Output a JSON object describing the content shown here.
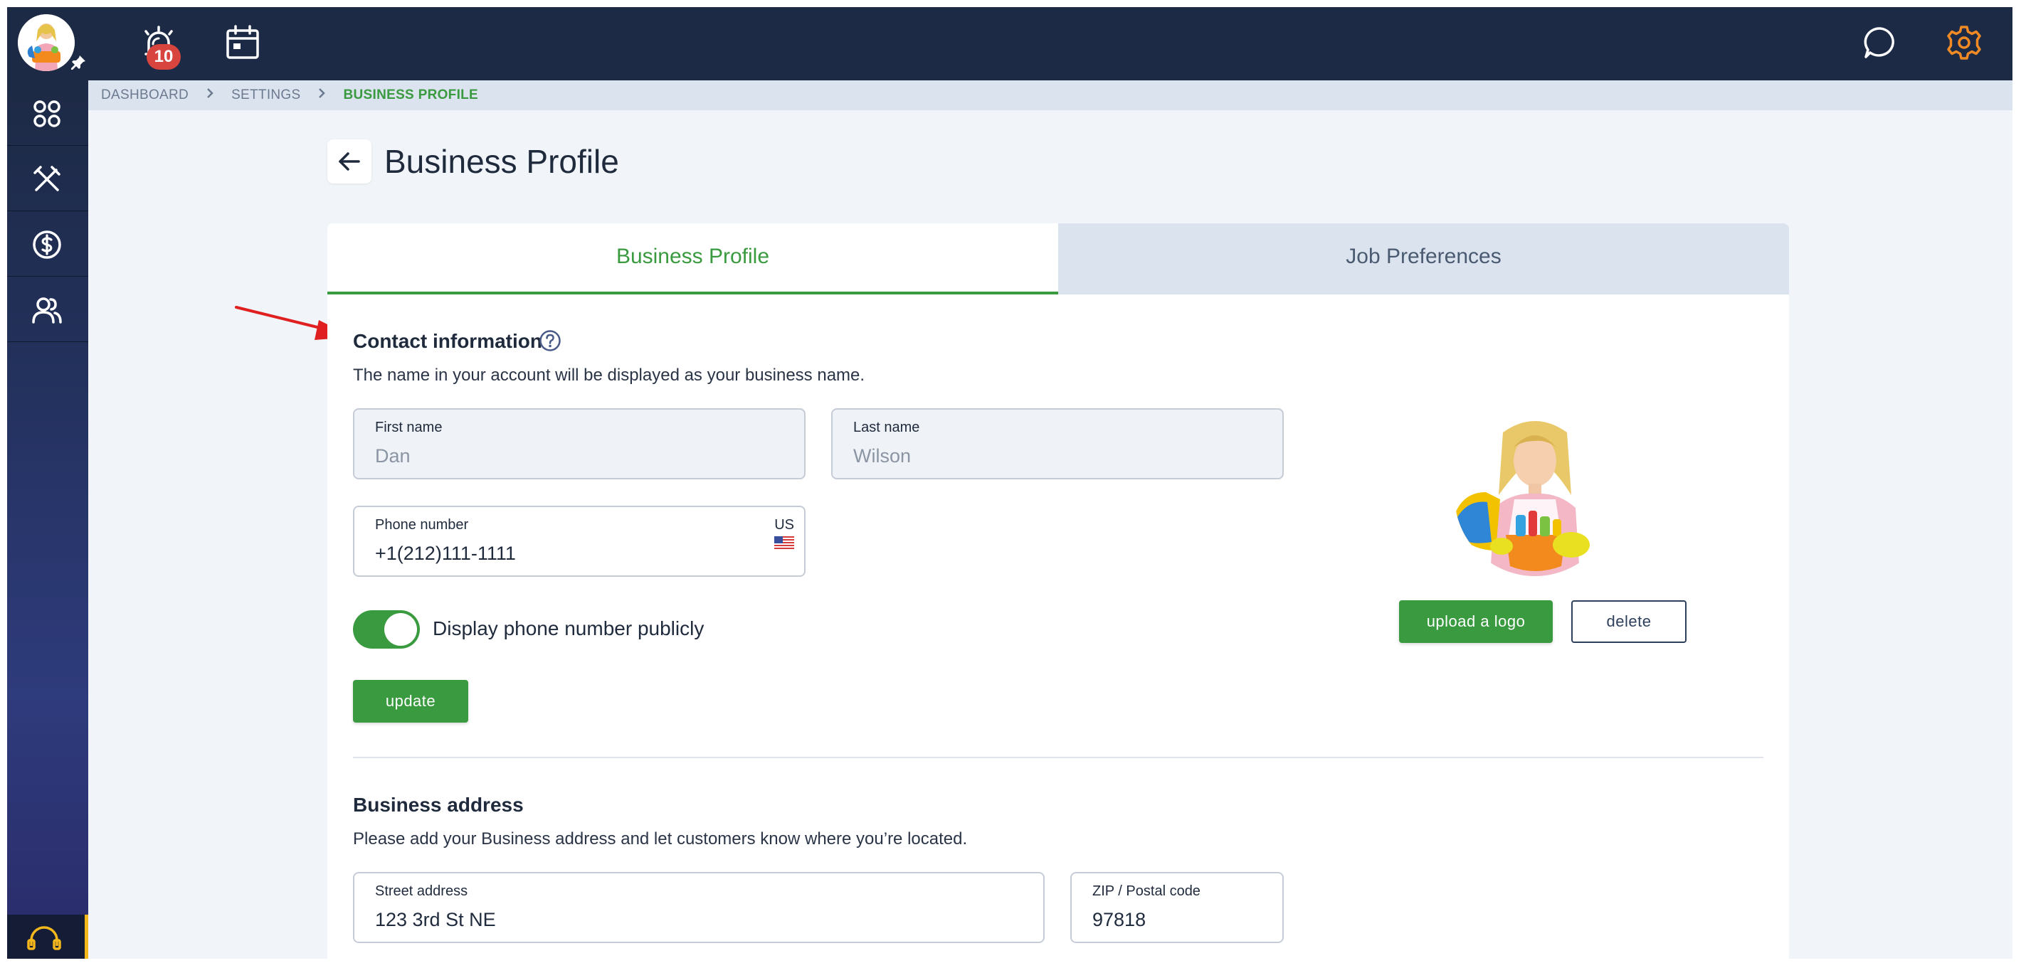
{
  "topbar": {
    "notification_count": "10"
  },
  "breadcrumb": {
    "items": [
      "DASHBOARD",
      "SETTINGS",
      "BUSINESS PROFILE"
    ]
  },
  "page": {
    "title": "Business Profile"
  },
  "tabs": [
    {
      "label": "Business Profile",
      "active": true
    },
    {
      "label": "Job Preferences",
      "active": false
    }
  ],
  "contact": {
    "title": "Contact information",
    "description": "The name in your account will be displayed as your business name.",
    "first_name": {
      "label": "First name",
      "value": "Dan"
    },
    "last_name": {
      "label": "Last name",
      "value": "Wilson"
    },
    "phone": {
      "label": "Phone number",
      "value": "+1(212)111-1111",
      "country": "US"
    },
    "display_phone": {
      "label": "Display phone number publicly",
      "enabled": true
    },
    "update_label": "update"
  },
  "logo": {
    "upload_label": "upload a logo",
    "delete_label": "delete"
  },
  "address": {
    "title": "Business address",
    "description": "Please add your Business address and let customers know where you’re located.",
    "street": {
      "label": "Street address",
      "value": "123 3rd St NE"
    },
    "zip": {
      "label": "ZIP / Postal code",
      "value": "97818"
    }
  },
  "colors": {
    "accent": "#3a9a3f",
    "navbar": "#1d2a45",
    "settings_icon": "#f08a24",
    "badge": "#d8453e"
  }
}
